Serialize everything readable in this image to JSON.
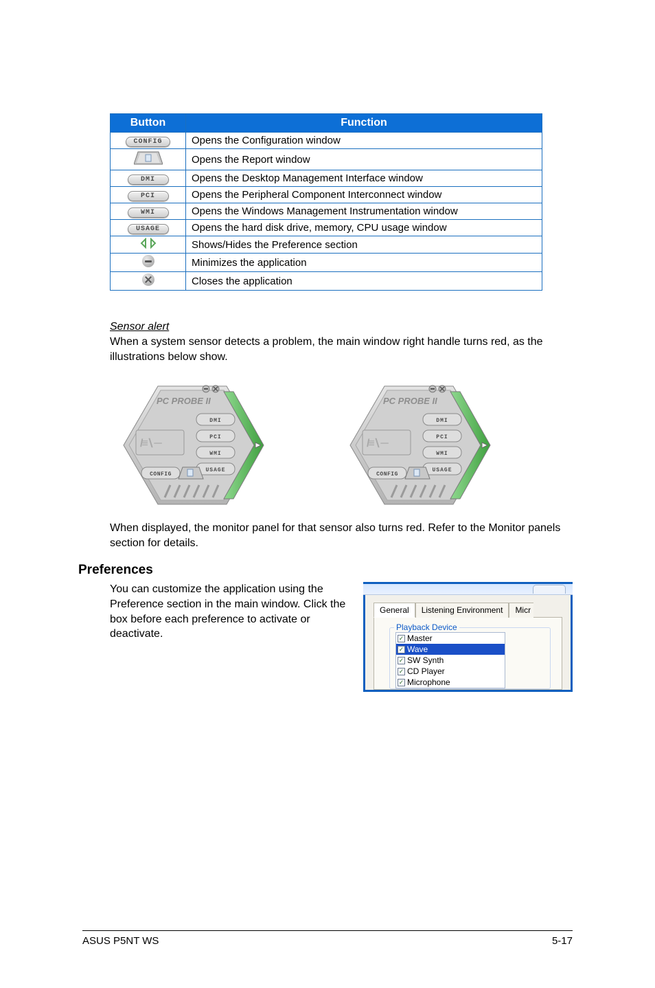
{
  "table": {
    "headers": {
      "button": "Button",
      "function": "Function"
    },
    "rows": [
      {
        "btn_label": "CONFIG",
        "btn_kind": "pill",
        "function": "Opens the Configuration window"
      },
      {
        "btn_label": "report",
        "btn_kind": "trapezoid",
        "function": "Opens the Report window"
      },
      {
        "btn_label": "DMI",
        "btn_kind": "pill",
        "function": "Opens the Desktop Management Interface window"
      },
      {
        "btn_label": "PCI",
        "btn_kind": "pill",
        "function": "Opens the Peripheral Component Interconnect window"
      },
      {
        "btn_label": "WMI",
        "btn_kind": "pill",
        "function": "Opens the Windows Management Instrumentation window"
      },
      {
        "btn_label": "USAGE",
        "btn_kind": "pill",
        "function": "Opens the hard disk drive, memory, CPU usage window"
      },
      {
        "btn_label": "arrows",
        "btn_kind": "arrows",
        "function": "Shows/Hides the Preference section"
      },
      {
        "btn_label": "minimize",
        "btn_kind": "minimize",
        "function": "Minimizes the application"
      },
      {
        "btn_label": "close",
        "btn_kind": "close",
        "function": "Closes the application"
      }
    ]
  },
  "sensor": {
    "title": "Sensor alert",
    "para1": "When a system sensor detects a problem, the main window right handle turns red, as the illustrations below show.",
    "para2": "When displayed, the monitor panel for that sensor also turns red. Refer to the Monitor panels section for details.",
    "hex_title": "PC PROBE II",
    "hex_buttons": {
      "dmi": "DMI",
      "pci": "PCI",
      "wmi": "WMI",
      "usage": "USAGE",
      "config": "CONFIG"
    }
  },
  "prefs": {
    "heading": "Preferences",
    "para": "You can customize the application using the Preference section in the main window. Click the box before each preference to activate or deactivate.",
    "tabs": {
      "general": "General",
      "listening": "Listening Environment",
      "micr": "Micr"
    },
    "fieldset_label": "Playback Device",
    "items": [
      {
        "label": "Master",
        "checked": true,
        "selected": false
      },
      {
        "label": "Wave",
        "checked": true,
        "selected": true
      },
      {
        "label": "SW Synth",
        "checked": true,
        "selected": false
      },
      {
        "label": "CD Player",
        "checked": true,
        "selected": false
      },
      {
        "label": "Microphone",
        "checked": true,
        "selected": false
      }
    ]
  },
  "footer": {
    "left": "ASUS P5NT WS",
    "right": "5-17"
  }
}
